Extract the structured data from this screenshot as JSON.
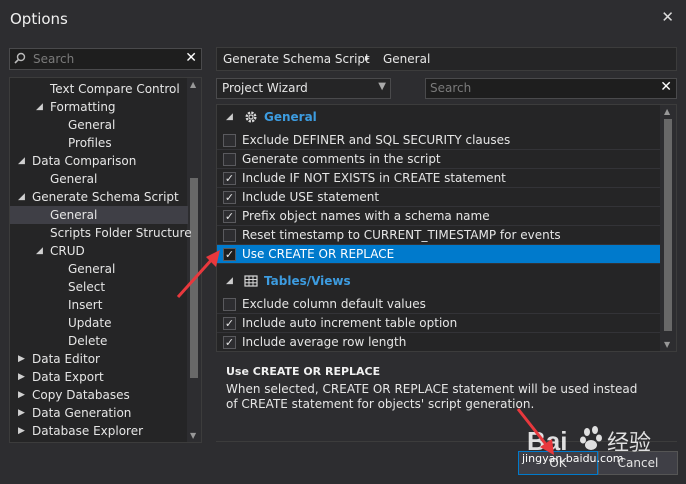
{
  "window": {
    "title": "Options"
  },
  "left_search": {
    "placeholder": "Search"
  },
  "tree": {
    "items": [
      {
        "label": "Text Compare Control",
        "depth": 2,
        "arrow": ""
      },
      {
        "label": "Formatting",
        "depth": 2,
        "arrow": "expanded"
      },
      {
        "label": "General",
        "depth": 3,
        "arrow": ""
      },
      {
        "label": "Profiles",
        "depth": 3,
        "arrow": ""
      },
      {
        "label": "Data Comparison",
        "depth": 1,
        "arrow": "expanded"
      },
      {
        "label": "General",
        "depth": 2,
        "arrow": ""
      },
      {
        "label": "Generate Schema Script",
        "depth": 1,
        "arrow": "expanded"
      },
      {
        "label": "General",
        "depth": 2,
        "arrow": "",
        "selected": true
      },
      {
        "label": "Scripts Folder Structure",
        "depth": 2,
        "arrow": ""
      },
      {
        "label": "CRUD",
        "depth": 2,
        "arrow": "expanded"
      },
      {
        "label": "General",
        "depth": 3,
        "arrow": ""
      },
      {
        "label": "Select",
        "depth": 3,
        "arrow": ""
      },
      {
        "label": "Insert",
        "depth": 3,
        "arrow": ""
      },
      {
        "label": "Update",
        "depth": 3,
        "arrow": ""
      },
      {
        "label": "Delete",
        "depth": 3,
        "arrow": ""
      },
      {
        "label": "Data Editor",
        "depth": 1,
        "arrow": "collapsed"
      },
      {
        "label": "Data Export",
        "depth": 1,
        "arrow": "collapsed"
      },
      {
        "label": "Copy Databases",
        "depth": 1,
        "arrow": "collapsed"
      },
      {
        "label": "Data Generation",
        "depth": 1,
        "arrow": "collapsed"
      },
      {
        "label": "Database Explorer",
        "depth": 1,
        "arrow": "collapsed"
      }
    ]
  },
  "breadcrumb": {
    "part1": "Generate Schema Script",
    "separator": "▸",
    "part2": "General"
  },
  "profile_dropdown": {
    "value": "Project Wizard"
  },
  "grid_search": {
    "placeholder": "Search"
  },
  "grid": {
    "group1": {
      "label": "General",
      "icon": "gear-icon"
    },
    "rows1": [
      {
        "label": "Exclude DEFINER and SQL SECURITY clauses",
        "checked": false
      },
      {
        "label": "Generate comments in the script",
        "checked": false
      },
      {
        "label": "Include IF NOT EXISTS in CREATE statement",
        "checked": true
      },
      {
        "label": "Include USE statement",
        "checked": true
      },
      {
        "label": "Prefix object names with a schema name",
        "checked": true
      },
      {
        "label": "Reset timestamp to CURRENT_TIMESTAMP for events",
        "checked": false
      },
      {
        "label": "Use CREATE OR REPLACE",
        "checked": true,
        "selected": true
      }
    ],
    "group2": {
      "label": "Tables/Views",
      "icon": "table-icon"
    },
    "rows2": [
      {
        "label": "Exclude column default values",
        "checked": false
      },
      {
        "label": "Include auto increment table option",
        "checked": true
      },
      {
        "label": "Include average row length",
        "checked": true
      }
    ]
  },
  "description": {
    "title": "Use CREATE OR REPLACE",
    "text": "When selected, CREATE OR REPLACE statement will be used instead of CREATE statement for objects' script generation."
  },
  "buttons": {
    "ok": "OK",
    "cancel": "Cancel"
  },
  "watermark": {
    "brand": "Bai",
    "brand_cn": "经验",
    "url": "jingyan.baidu.com"
  },
  "colors": {
    "accent": "#007acc",
    "group_label": "#3d9ce0",
    "annotation": "#e8383d",
    "background": "#2d2d30"
  }
}
